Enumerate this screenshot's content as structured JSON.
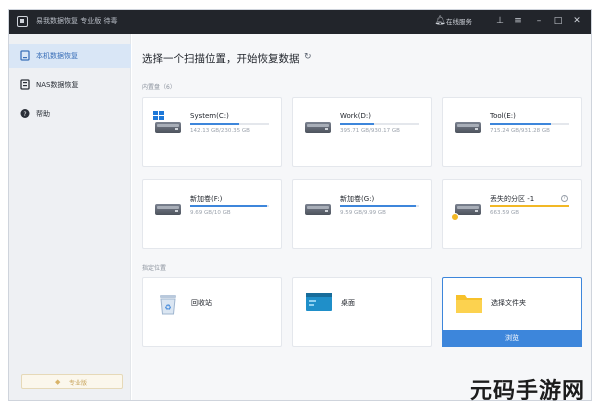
{
  "window": {
    "title": "易我数据恢复 专业版 待毒",
    "online_service": "在线服务"
  },
  "sidebar": {
    "items": [
      {
        "label": "本机数据恢复",
        "icon": "computer-icon",
        "active": true
      },
      {
        "label": "NAS数据恢复",
        "icon": "nas-icon",
        "active": false
      },
      {
        "label": "帮助",
        "icon": "help-icon",
        "active": false
      }
    ],
    "pro_label": "专业版"
  },
  "main": {
    "title": "选择一个扫描位置，开始恢复数据",
    "drives_section": "内置盘（6）",
    "drives": [
      {
        "name": "System(C:)",
        "size": "142.13 GB/230.35 GB",
        "used": 0.62,
        "icon": "windows-drive-icon"
      },
      {
        "name": "Work(D:)",
        "size": "395.71 GB/930.17 GB",
        "used": 0.43,
        "icon": "hard-drive-icon"
      },
      {
        "name": "Tool(E:)",
        "size": "715.24 GB/931.28 GB",
        "used": 0.77,
        "icon": "hard-drive-icon"
      },
      {
        "name": "新加卷(F:)",
        "size": "9.69 GB/10 GB",
        "used": 0.97,
        "icon": "hard-drive-icon"
      },
      {
        "name": "新加卷(G:)",
        "size": "9.59 GB/9.99 GB",
        "used": 0.96,
        "icon": "hard-drive-icon"
      },
      {
        "name": "丢失的分区 -1",
        "size": "663.59 GB",
        "used": 1.0,
        "icon": "lost-partition-icon"
      }
    ],
    "locations_section": "指定位置",
    "locations": [
      {
        "label": "回收站",
        "icon": "recycle-bin-icon"
      },
      {
        "label": "桌面",
        "icon": "desktop-icon"
      },
      {
        "label": "选择文件夹",
        "icon": "folder-icon",
        "button": "浏览"
      }
    ]
  },
  "watermark": "元码手游网",
  "colors": {
    "accent": "#3d86db",
    "lost": "#f2b825",
    "titlebar": "#22252b"
  }
}
